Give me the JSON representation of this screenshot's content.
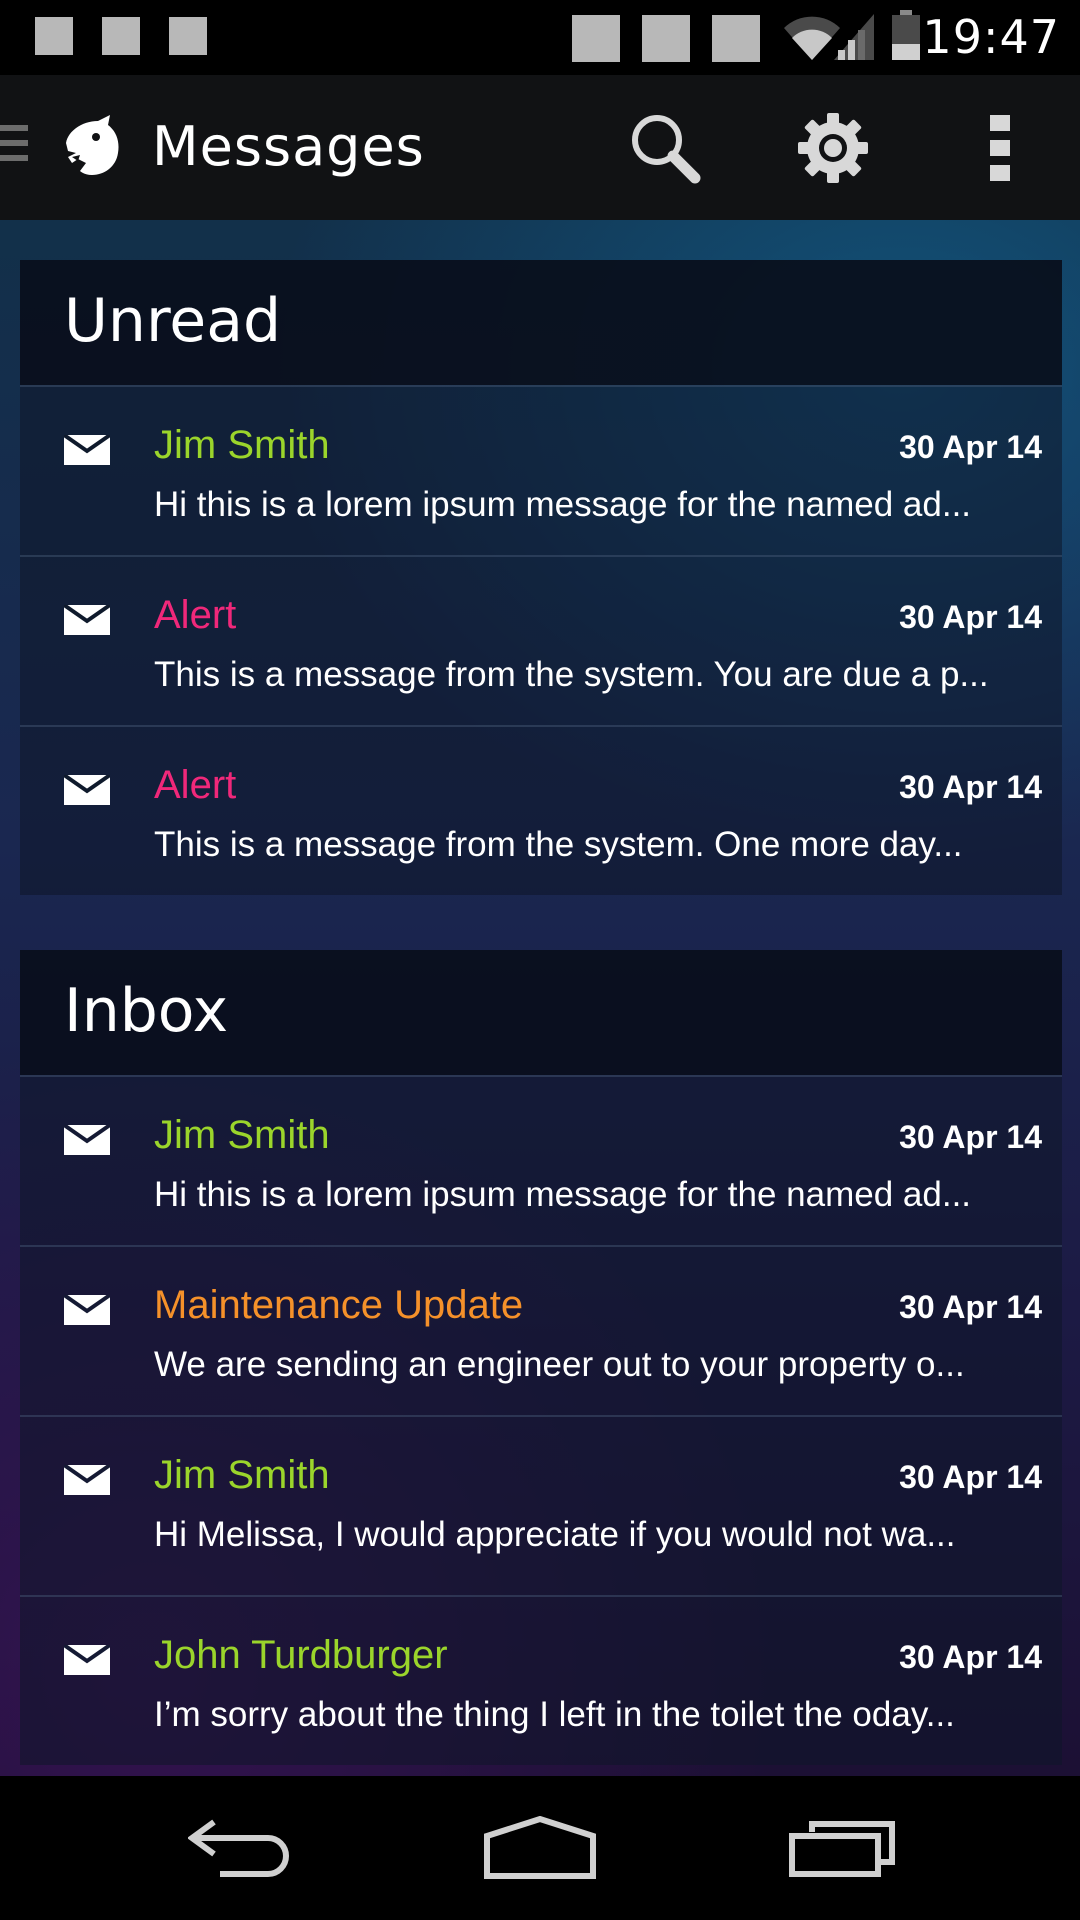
{
  "status_bar": {
    "time": "19:47",
    "icons": [
      "notification-icon",
      "notification-icon",
      "notification-icon",
      "status-icon",
      "status-icon",
      "status-icon",
      "wifi-icon",
      "signal-icon",
      "battery-icon"
    ]
  },
  "action_bar": {
    "title": "Messages",
    "icons": [
      "drawer-icon",
      "panther-logo-icon",
      "search-icon",
      "gear-icon",
      "overflow-menu-icon"
    ]
  },
  "sections": [
    {
      "title": "Unread",
      "messages": [
        {
          "sender": "Jim Smith",
          "date": "30 Apr 14",
          "preview": "Hi this is a lorem ipsum message for the named ad...",
          "color": "#9bd52b"
        },
        {
          "sender": "Alert",
          "date": "30 Apr 14",
          "preview": "This is a message from the system. You are due a p...",
          "color": "#f0287a"
        },
        {
          "sender": "Alert",
          "date": "30 Apr 14",
          "preview": "This is a message from the system. One more day...",
          "color": "#f0287a"
        }
      ]
    },
    {
      "title": "Inbox",
      "messages": [
        {
          "sender": "Jim Smith",
          "date": "30 Apr 14",
          "preview": "Hi this is a lorem ipsum message for the named ad...",
          "color": "#9bd52b"
        },
        {
          "sender": "Maintenance Update",
          "date": "30 Apr 14",
          "preview": "We are sending an engineer out to your property o...",
          "color": "#f5912a"
        },
        {
          "sender": "Jim Smith",
          "date": "30 Apr 14",
          "preview": "Hi Melissa, I would appreciate if you would not wa...",
          "color": "#9bd52b"
        },
        {
          "sender": "John Turdburger",
          "date": "30 Apr 14",
          "preview": "I’m sorry about the thing I left in the toilet the oday...",
          "color": "#9bd52b"
        }
      ]
    }
  ],
  "nav_bar": {
    "icons": [
      "back-icon",
      "home-icon",
      "recents-icon"
    ]
  },
  "colors": {
    "sender_green": "#9bd52b",
    "sender_pink": "#f0287a",
    "sender_orange": "#f5912a",
    "action_bar_bg": "#111214"
  }
}
